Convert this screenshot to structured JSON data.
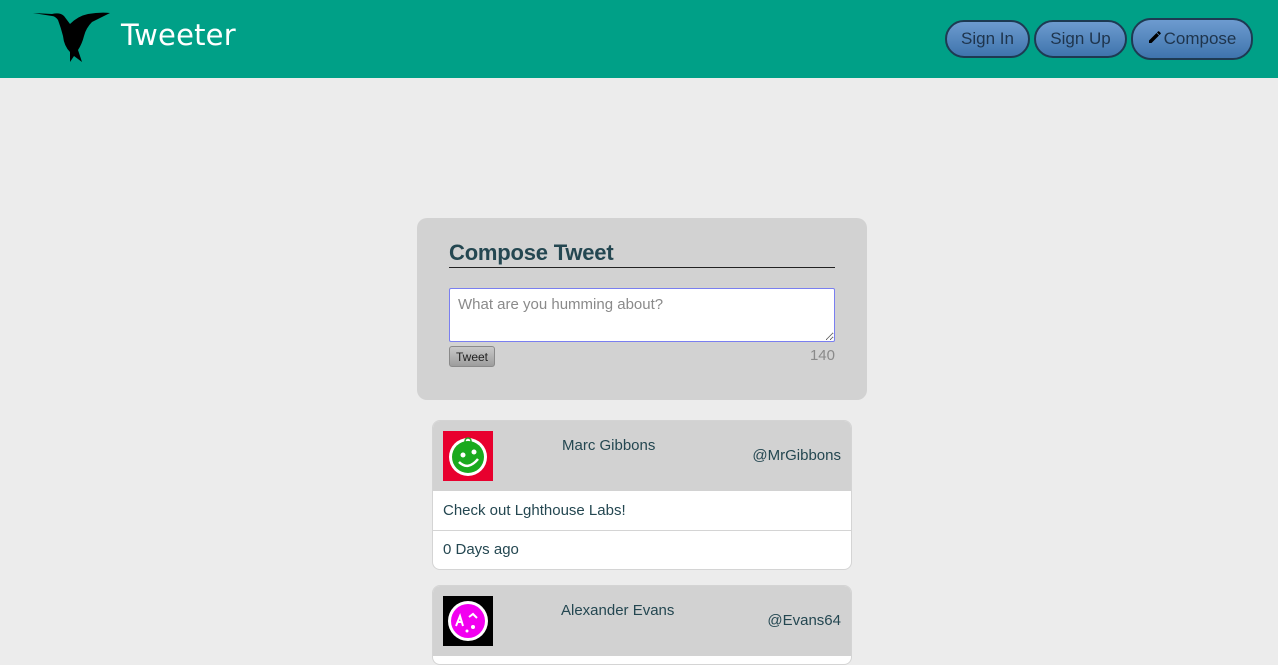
{
  "nav": {
    "brand": "Tweeter",
    "signin_label": "Sign In",
    "signup_label": "Sign Up",
    "compose_label": "Compose",
    "compose_icon": "pencil-icon",
    "logo_icon": "hummingbird-icon"
  },
  "compose": {
    "title": "Compose Tweet",
    "placeholder": "What are you humming about?",
    "tweet_label": "Tweet",
    "counter": "140"
  },
  "tweets": [
    {
      "name": "Marc Gibbons",
      "handle": "@MrGibbons",
      "text": "Check out Lghthouse Labs!",
      "time": "0 Days ago",
      "avatar_bg": "#e8002e",
      "avatar_face": "#1aaa1e"
    },
    {
      "name": "Alexander Evans",
      "handle": "@Evans64",
      "avatar_bg": "#000000",
      "avatar_face": "#f200f0"
    }
  ],
  "colors": {
    "navbar": "#00a087",
    "page_bg": "#ececec",
    "panel": "#d2d2d2",
    "text": "#244751"
  }
}
